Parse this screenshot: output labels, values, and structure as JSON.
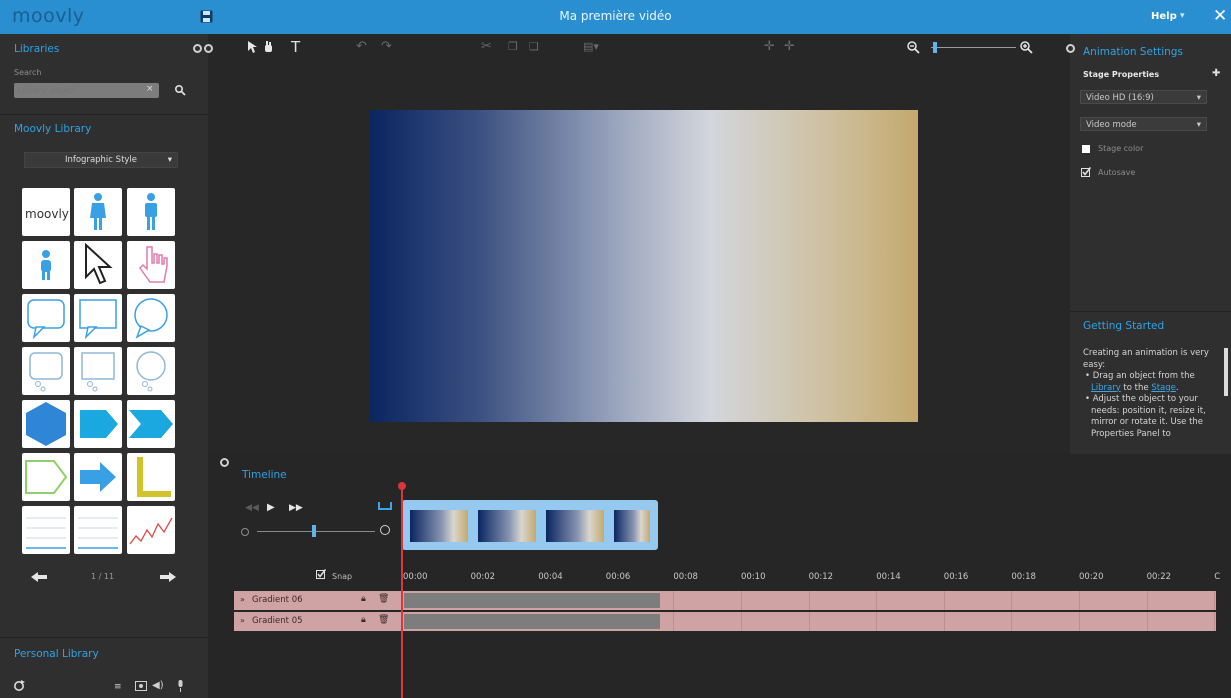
{
  "app": {
    "logo": "moovly",
    "title": "Ma première vidéo",
    "help_label": "Help",
    "colors": {
      "accent": "#2a8fd0",
      "panel": "#2f2f2f",
      "canvas": "#272727",
      "track": "#cfa3a3",
      "playhead": "#d9363e"
    }
  },
  "libraries": {
    "header": "Libraries",
    "search_label": "Search",
    "search_placeholder": "Library, object",
    "moovly_library_header": "Moovly Library",
    "style_selected": "Infographic Style",
    "pager": "1 / 11",
    "personal_library_header": "Personal Library",
    "thumbnails": [
      "moovly-logo",
      "person-female-icon",
      "person-male-icon",
      "child-icon",
      "arrow-cursor-icon",
      "hand-cursor-icon",
      "speech-bubble-rounded-icon",
      "speech-bubble-square-icon",
      "speech-bubble-round-icon",
      "thought-bubble-rounded-icon",
      "thought-bubble-square-icon",
      "thought-bubble-round-icon",
      "hexagon-shape",
      "arrow-tag-shape",
      "chevron-shape",
      "pentagon-outline-shape",
      "arrow-right-shape",
      "corner-l-shape",
      "lined-paper-shape",
      "lined-paper-shape",
      "line-chart-shape"
    ],
    "logo_text": "moovly"
  },
  "animation_settings": {
    "header": "Animation Settings",
    "stage_properties_label": "Stage Properties",
    "format_selected": "Video HD (16:9)",
    "mode_selected": "Video mode",
    "stage_color_label": "Stage color",
    "autosave_label": "Autosave",
    "stage_color_checked": false,
    "autosave_checked": true
  },
  "getting_started": {
    "header": "Getting Started",
    "intro": "Creating an animation is very easy:",
    "bullet1_prefix": "Drag an object from the ",
    "bullet1_link1": "Library",
    "bullet1_mid": " to the ",
    "bullet1_link2": "Stage",
    "bullet1_suffix": ".",
    "bullet2": "Adjust the object to your needs: position it, resize it, mirror or rotate it. Use the Properties Panel to"
  },
  "timeline": {
    "header": "Timeline",
    "snap_label": "Snap",
    "snap_checked": true,
    "ticks": [
      "00:00",
      "00:02",
      "00:04",
      "00:06",
      "00:08",
      "00:10",
      "00:12",
      "00:14",
      "00:16",
      "00:18",
      "00:20",
      "00:22",
      "C"
    ],
    "tracks": [
      {
        "name": "Gradient 06"
      },
      {
        "name": "Gradient 05"
      }
    ]
  }
}
